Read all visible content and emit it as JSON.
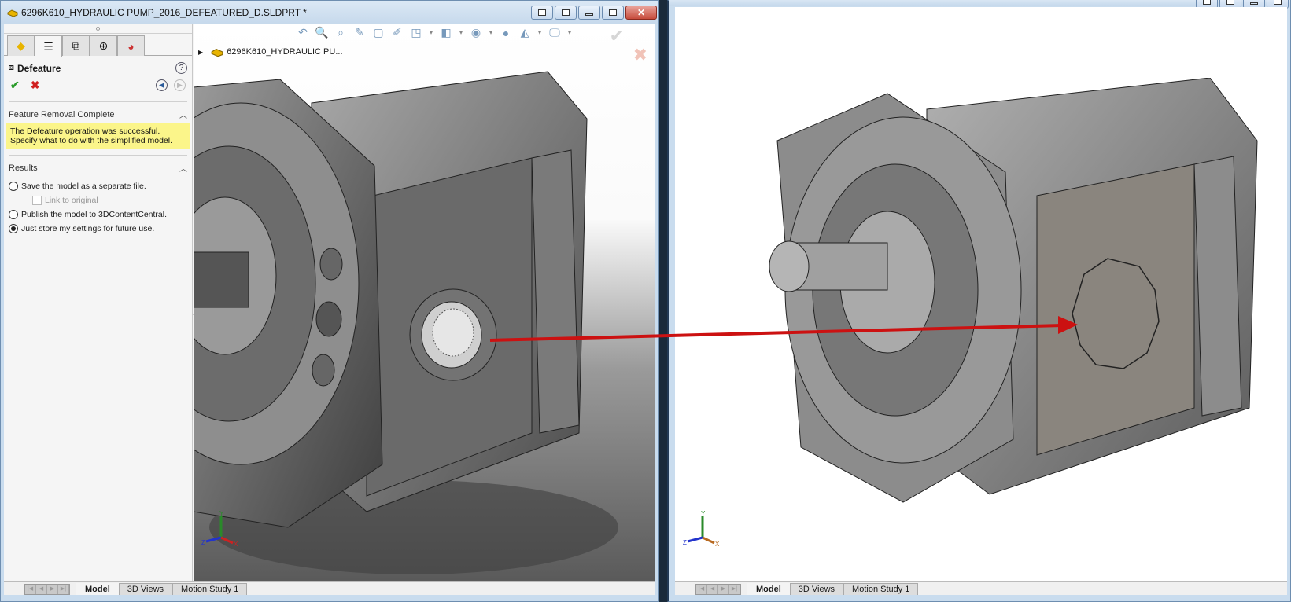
{
  "left_window": {
    "title": "6296K610_HYDRAULIC PUMP_2016_DEFEATURED_D.SLDPRT *",
    "window_buttons": [
      "tile-left",
      "tile-right",
      "minimize",
      "maximize",
      "close"
    ],
    "property_manager": {
      "tabs": [
        "feature-manager",
        "property-manager",
        "configuration-manager",
        "dimxpert-manager",
        "display-manager"
      ],
      "active_tab": 1,
      "title": "Defeature",
      "help_label": "?",
      "ok_label": "✔",
      "cancel_label": "✖",
      "back_label": "◀",
      "next_label": "▶",
      "groups": [
        {
          "title": "Feature Removal Complete",
          "message": "The Defeature operation was successful. Specify what to do with the simplified model."
        },
        {
          "title": "Results",
          "options": [
            {
              "label": "Save the model as a separate file.",
              "type": "radio",
              "checked": false
            },
            {
              "label": "Link to original",
              "type": "checkbox",
              "checked": false,
              "disabled": true
            },
            {
              "label": "Publish the model to 3DContentCentral.",
              "type": "radio",
              "checked": false
            },
            {
              "label": "Just store my settings for future use.",
              "type": "radio",
              "checked": true
            }
          ]
        }
      ]
    },
    "tree_root": "6296K610_HYDRAULIC PU...",
    "confirm_ok": "✔",
    "confirm_cancel": "✖",
    "triad": {
      "x": "X",
      "y": "Y",
      "z": "Z"
    },
    "bottom_tabs": [
      "Model",
      "3D Views",
      "Motion Study 1"
    ],
    "active_bottom_tab": "Model"
  },
  "right_window": {
    "triad": {
      "x": "X",
      "y": "Y",
      "z": "Z"
    },
    "bottom_tabs": [
      "Model",
      "3D Views",
      "Motion Study 1"
    ],
    "active_bottom_tab": "Model"
  },
  "heads_up_toolbar": {
    "icons": [
      "previous-view-icon",
      "zoom-to-fit-icon",
      "zoom-to-area-icon",
      "section-view-icon",
      "view-selector-icon",
      "dynamic-annotation-icon",
      "view-orientation-icon",
      "display-style-icon",
      "hide-show-icon",
      "edit-appearance-icon",
      "apply-scene-icon",
      "view-settings-icon"
    ]
  },
  "colors": {
    "callout_arrow": "#cc1111",
    "message_bg": "#fbf58a",
    "titlebar": "#c6d9ec"
  }
}
